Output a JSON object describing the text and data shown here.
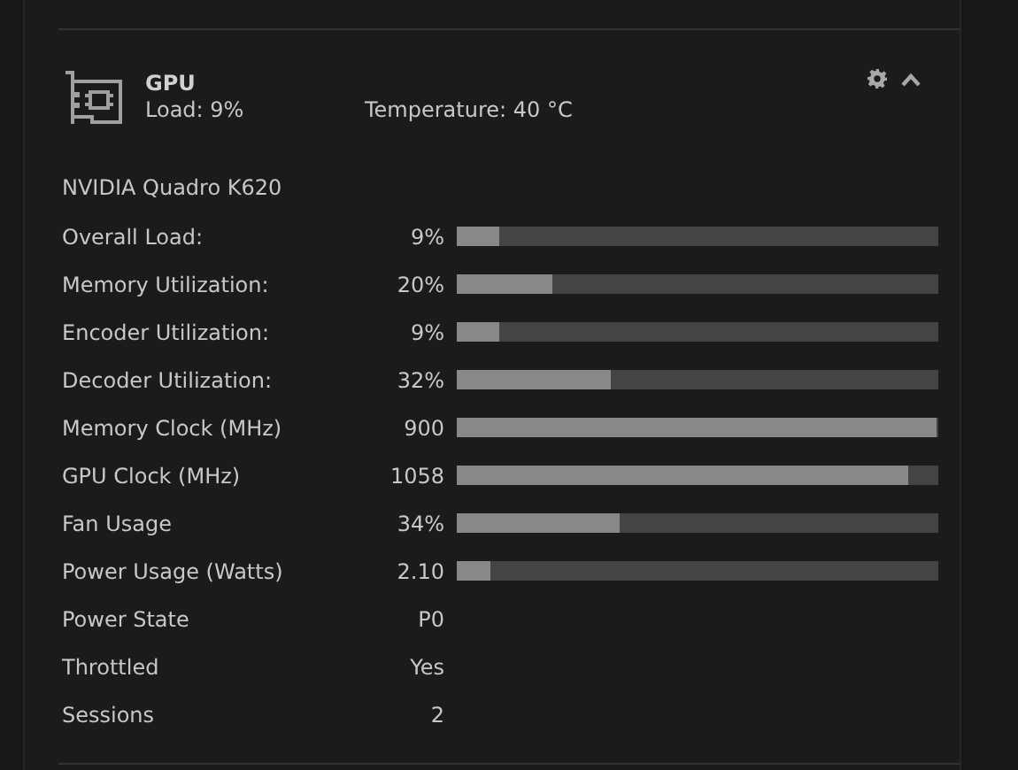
{
  "header": {
    "title": "GPU",
    "load": "Load: 9%",
    "temperature": "Temperature: 40 °C"
  },
  "device": "NVIDIA Quadro K620",
  "rows": [
    {
      "kind": "bar",
      "label": "Overall Load:",
      "value": "9%",
      "level": 0.09
    },
    {
      "kind": "bar",
      "label": "Memory Utilization:",
      "value": "20%",
      "level": 0.2
    },
    {
      "kind": "bar",
      "label": "Encoder Utilization:",
      "value": "9%",
      "level": 0.09
    },
    {
      "kind": "bar",
      "label": "Decoder Utilization:",
      "value": "32%",
      "level": 0.32
    },
    {
      "kind": "bar",
      "label": "Memory Clock (MHz)",
      "value": "900",
      "level": 1.0
    },
    {
      "kind": "bar",
      "label": "GPU Clock (MHz)",
      "value": "1058",
      "level": 0.94
    },
    {
      "kind": "bar",
      "label": "Fan Usage",
      "value": "34%",
      "level": 0.34
    },
    {
      "kind": "bar",
      "label": "Power Usage (Watts)",
      "value": "2.10",
      "level": 0.07
    },
    {
      "kind": "text",
      "label": "Power State",
      "value": "P0"
    },
    {
      "kind": "text",
      "label": "Throttled",
      "value": "Yes"
    },
    {
      "kind": "text",
      "label": "Sessions",
      "value": "2"
    }
  ]
}
